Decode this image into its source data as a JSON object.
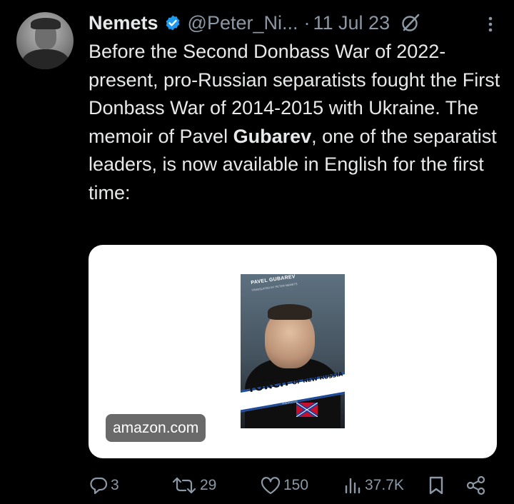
{
  "author": {
    "name": "Nemets",
    "handle": "@Peter_Ni...",
    "separator": "·",
    "date": "11 Jul 23"
  },
  "tweet": {
    "text_before": "Before the Second Donbass War of 2022-present, pro-Russian separatists fought the First Donbass War of 2014-2015 with Ukraine. The memoir of Pavel ",
    "text_bold": "Gubarev",
    "text_after": ", one of the separatist leaders, is now available in English for the first time:"
  },
  "card": {
    "domain": "amazon.com",
    "book": {
      "author": "PAVEL GUBAREV",
      "translator": "TRANSLATED BY PETER NEMETS",
      "title_main": "TORCH",
      "title_rest": "OF NEW RUSSIA",
      "subtitle": "НОВОРОССИЯ"
    }
  },
  "actions": {
    "replies": "3",
    "reposts": "29",
    "likes": "150",
    "views": "37.7K"
  },
  "colors": {
    "background": "#000000",
    "text": "#e7e9ea",
    "muted": "#8b98a5",
    "verified": "#1d9bf0"
  },
  "icons": [
    "verified-badge-icon",
    "grok-icon",
    "more-icon",
    "reply-icon",
    "repost-icon",
    "like-icon",
    "views-icon",
    "bookmark-icon",
    "share-icon"
  ]
}
